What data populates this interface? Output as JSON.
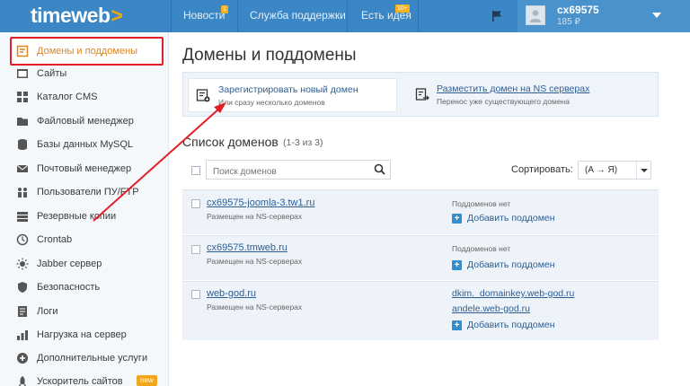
{
  "brand": {
    "logo": "timeweb",
    "logo_arrow": ">",
    "accent_color": "#3b86c4",
    "highlight_color": "#e31e24"
  },
  "topnav": {
    "news": {
      "label": "Новости",
      "badge": "1"
    },
    "support": {
      "label": "Служба поддержки"
    },
    "ideas": {
      "label": "Есть идея",
      "badge": "10+"
    },
    "flag_icon": "flag-icon"
  },
  "user": {
    "name": "cx69575",
    "balance": "185 ₽"
  },
  "sidebar": {
    "items": [
      {
        "label": "Домены и поддомены",
        "icon": "domain-icon",
        "active": true
      },
      {
        "label": "Сайты",
        "icon": "sites-icon"
      },
      {
        "label": "Каталог CMS",
        "icon": "cms-icon"
      },
      {
        "label": "Файловый менеджер",
        "icon": "folder-icon"
      },
      {
        "label": "Базы данных MySQL",
        "icon": "database-icon"
      },
      {
        "label": "Почтовый менеджер",
        "icon": "mail-icon"
      },
      {
        "label": "Пользователи ПУ/FTP",
        "icon": "users-icon"
      },
      {
        "label": "Резервные копии",
        "icon": "backup-icon"
      },
      {
        "label": "Crontab",
        "icon": "clock-icon"
      },
      {
        "label": "Jabber сервер",
        "icon": "jabber-icon"
      },
      {
        "label": "Безопасность",
        "icon": "shield-icon"
      },
      {
        "label": "Логи",
        "icon": "logs-icon"
      },
      {
        "label": "Нагрузка на сервер",
        "icon": "load-icon"
      },
      {
        "label": "Дополнительные услуги",
        "icon": "services-icon"
      },
      {
        "label": "Ускоритель сайтов",
        "icon": "rocket-icon",
        "badge": "new"
      }
    ]
  },
  "main": {
    "title": "Домены и поддомены",
    "actions": [
      {
        "title": "Зарегистрировать новый домен",
        "subtitle": "Или сразу несколько доменов",
        "icon": "register-domain-icon"
      },
      {
        "title": "Разместить домен на NS серверах",
        "subtitle": "Перенос уже существующего домена",
        "icon": "transfer-domain-icon"
      }
    ],
    "list": {
      "title": "Список доменов",
      "count": "(1-3 из 3)",
      "search_placeholder": "Поиск доменов",
      "sort_label": "Сортировать:",
      "sort_value": "(А → Я)"
    },
    "domains": [
      {
        "name": "cx69575-joomla-3.tw1.ru",
        "note": "Размещен на NS-серверах",
        "subdomains_label": "Поддоменов нет",
        "subdomains": [],
        "add_label": "Добавить поддомен"
      },
      {
        "name": "cx69575.tmweb.ru",
        "note": "Размещен на NS-серверах",
        "subdomains_label": "Поддоменов нет",
        "subdomains": [],
        "add_label": "Добавить поддомен"
      },
      {
        "name": "web-god.ru",
        "note": "Размещен на NS-серверах",
        "subdomains_label": "",
        "subdomains": [
          "dkim._domainkey.web-god.ru",
          "andele.web-god.ru"
        ],
        "add_label": "Добавить поддомен"
      }
    ]
  }
}
